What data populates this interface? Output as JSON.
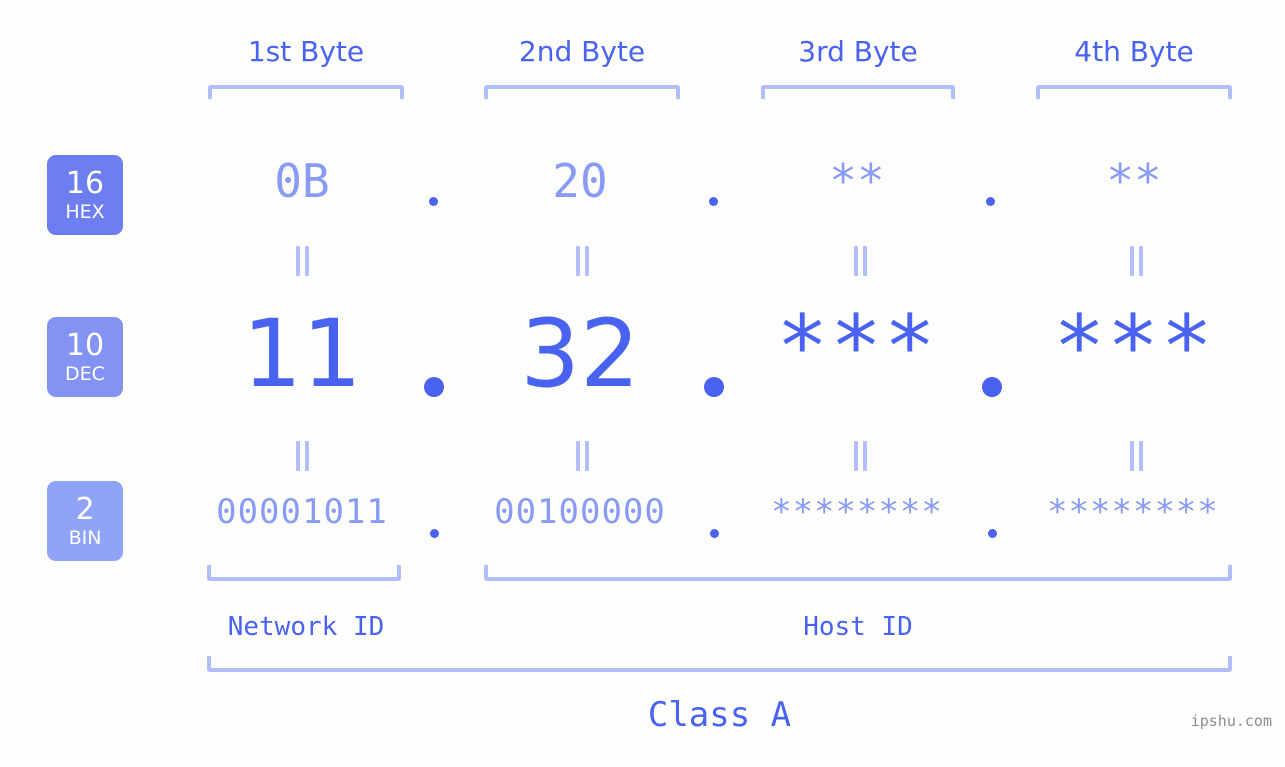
{
  "background_color": "#fdfefb",
  "colors": {
    "accent_strong": "#4963f0",
    "accent_light": "#8a9bf4",
    "bracket": "#b3bdfb",
    "badge_hex": "#6c7ef0",
    "badge_dec": "#8293f3",
    "badge_bin": "#8fa3f7",
    "watermark": "#8d8d8d"
  },
  "byte_headers": [
    {
      "label": "1st Byte"
    },
    {
      "label": "2nd Byte"
    },
    {
      "label": "3rd Byte"
    },
    {
      "label": "4th Byte"
    }
  ],
  "bases": [
    {
      "number": "16",
      "name": "HEX"
    },
    {
      "number": "10",
      "name": "DEC"
    },
    {
      "number": "2",
      "name": "BIN"
    }
  ],
  "rows": {
    "hex": {
      "base_number": "16",
      "base_name": "HEX",
      "values": [
        "0B",
        "20",
        "**",
        "**"
      ]
    },
    "dec": {
      "base_number": "10",
      "base_name": "DEC",
      "values": [
        "11",
        "32",
        "***",
        "***"
      ]
    },
    "bin": {
      "base_number": "2",
      "base_name": "BIN",
      "values": [
        "00001011",
        "00100000",
        "********",
        "********"
      ]
    }
  },
  "separators": {
    "dot": "."
  },
  "equality": {
    "symbol": "="
  },
  "segments": [
    {
      "label": "Network ID"
    },
    {
      "label": "Host ID"
    }
  ],
  "class": {
    "label": "Class A"
  },
  "watermark": {
    "text": "ipshu.com"
  }
}
